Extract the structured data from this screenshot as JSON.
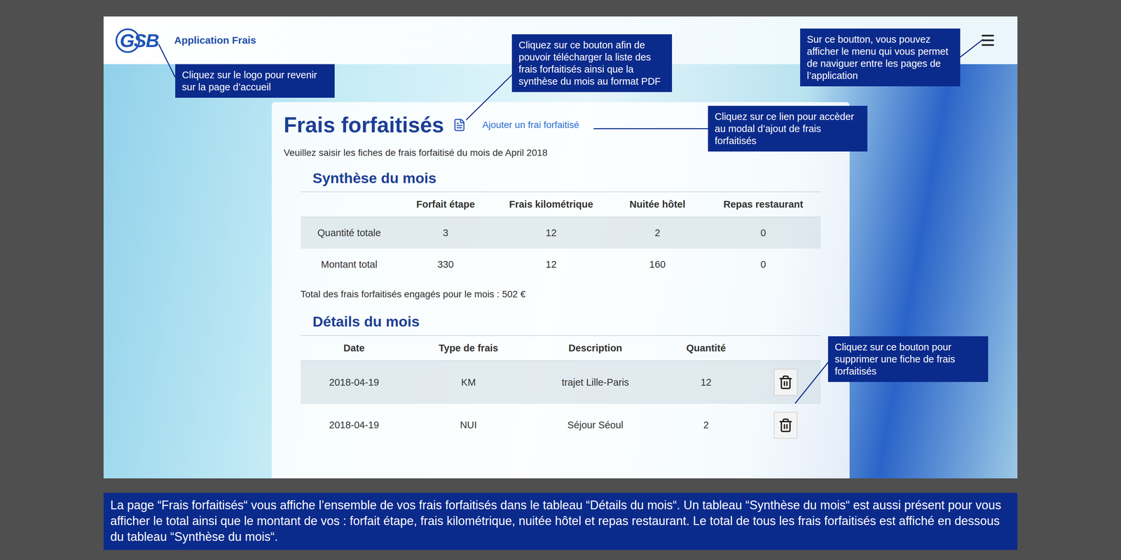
{
  "app": {
    "logo": "GSB",
    "title": "Application Frais"
  },
  "page": {
    "title": "Frais forfaitisés",
    "add_link": "Ajouter un frai forfaitisé",
    "subtitle": "Veuillez saisir les fiches de frais forfaitisé du mois de April 2018"
  },
  "synthesis": {
    "title": "Synthèse du mois",
    "columns": [
      "Forfait étape",
      "Frais kilométrique",
      "Nuitée hôtel",
      "Repas restaurant"
    ],
    "rows": [
      {
        "label": "Quantité totale",
        "values": [
          "3",
          "12",
          "2",
          "0"
        ]
      },
      {
        "label": "Montant total",
        "values": [
          "330",
          "12",
          "160",
          "0"
        ]
      }
    ],
    "total": "Total des frais forfaitisés engagés pour le mois : 502 €"
  },
  "details": {
    "title": "Détails du mois",
    "columns": [
      "Date",
      "Type de frais",
      "Description",
      "Quantité"
    ],
    "rows": [
      {
        "date": "2018-04-19",
        "type": "KM",
        "description": "trajet Lille-Paris",
        "quantity": "12"
      },
      {
        "date": "2018-04-19",
        "type": "NUI",
        "description": "Séjour Séoul",
        "quantity": "2"
      }
    ]
  },
  "callouts": [
    {
      "target": "logo",
      "text": "Cliquez sur le logo pour revenir sur la page d’accueil"
    },
    {
      "target": "pdf",
      "text": "Cliquez sur ce bouton afin de pouvoir télécharger la liste des frais forfaitisés ainsi que la synthèse du mois au format PDF"
    },
    {
      "target": "menu",
      "text": "Sur ce boutton, vous pouvez afficher le menu qui vous permet de naviguer entre les pages de l’application"
    },
    {
      "target": "add",
      "text": "Cliquez sur ce lien pour accèder au modal d’ajout de frais forfaitisés"
    },
    {
      "target": "delete",
      "text": "Cliquez sur ce bouton pour supprimer une fiche de frais forfaitisés"
    }
  ],
  "caption": "La page “Frais forfaitisés“ vous affiche l’ensemble de vos frais forfaitisés dans le tableau “Détails du mois“. Un tableau “Synthèse du mois“ est aussi présent pour vous afficher le total ainsi que le montant de vos : forfait étape, frais kilométrique, nuitée hôtel et repas restaurant. Le total de tous les frais forfaitisés est affiché en dessous du tableau “Synthèse du mois“."
}
